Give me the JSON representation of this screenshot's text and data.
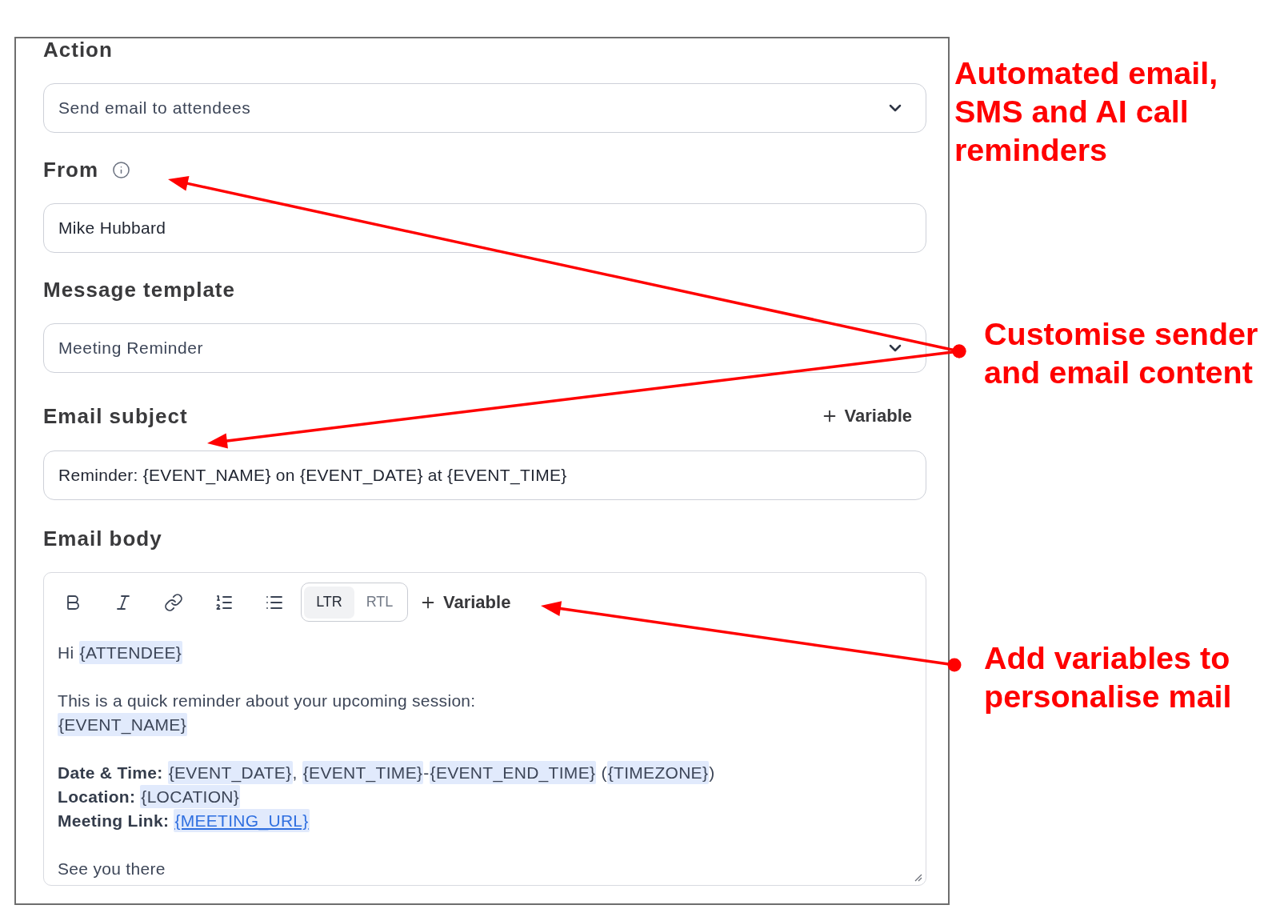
{
  "fields": [
    {
      "kind": "select",
      "label": "Action",
      "info": false,
      "value": "Send email to attendees"
    },
    {
      "kind": "text",
      "label": "From",
      "info": true,
      "value": "Mike Hubbard"
    },
    {
      "kind": "select",
      "label": "Message template",
      "info": false,
      "value": "Meeting Reminder"
    },
    {
      "kind": "text",
      "label": "Email subject",
      "info": false,
      "action": "Variable",
      "value": "Reminder: {EVENT_NAME} on {EVENT_DATE} at {EVENT_TIME}"
    }
  ],
  "email_body": {
    "label": "Email body",
    "direction_options": [
      {
        "label": "LTR",
        "selected": true
      },
      {
        "label": "RTL",
        "selected": false
      }
    ],
    "add_variable": "Variable",
    "paragraphs": [
      {
        "lines": [
          {
            "segments": [
              {
                "kind": "text",
                "text": "Hi "
              },
              {
                "kind": "variable",
                "text": "{ATTENDEE}"
              }
            ]
          }
        ]
      },
      {
        "lines": [
          {
            "segments": [
              {
                "kind": "text",
                "text": "This is a quick reminder about your upcoming session:"
              }
            ]
          },
          {
            "segments": [
              {
                "kind": "variable",
                "text": "{EVENT_NAME}"
              }
            ]
          }
        ]
      },
      {
        "lines": [
          {
            "segments": [
              {
                "kind": "bold",
                "text": "Date & Time: "
              },
              {
                "kind": "variable",
                "text": "{EVENT_DATE}"
              },
              {
                "kind": "text",
                "text": ", "
              },
              {
                "kind": "variable",
                "text": "{EVENT_TIME}"
              },
              {
                "kind": "text",
                "text": "-"
              },
              {
                "kind": "variable",
                "text": "{EVENT_END_TIME}"
              },
              {
                "kind": "text",
                "text": " ("
              },
              {
                "kind": "variable",
                "text": "{TIMEZONE}"
              },
              {
                "kind": "text",
                "text": ")"
              }
            ]
          },
          {
            "segments": [
              {
                "kind": "bold",
                "text": "Location: "
              },
              {
                "kind": "variable",
                "text": "{LOCATION}"
              }
            ]
          },
          {
            "segments": [
              {
                "kind": "bold",
                "text": "Meeting Link: "
              },
              {
                "kind": "link",
                "text": "{MEETING_URL}"
              }
            ]
          }
        ]
      },
      {
        "lines": [
          {
            "segments": [
              {
                "kind": "text",
                "text": "See you there"
              }
            ]
          }
        ]
      }
    ]
  },
  "annotations": [
    {
      "text": "Automated email, SMS and AI call reminders"
    },
    {
      "text": "Customise sender and email content"
    },
    {
      "text": "Add variables to personalise mail"
    }
  ]
}
